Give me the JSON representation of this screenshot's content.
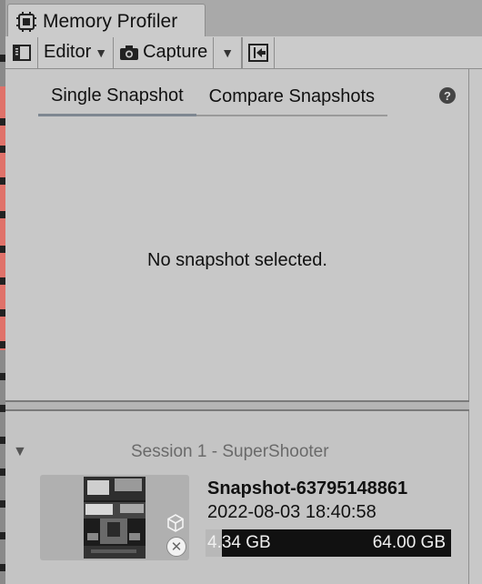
{
  "window": {
    "tab_title": "Memory Profiler"
  },
  "toolbar": {
    "editor_label": "Editor",
    "capture_label": "Capture"
  },
  "view_tabs": [
    {
      "label": "Single Snapshot",
      "active": true
    },
    {
      "label": "Compare Snapshots",
      "active": false
    }
  ],
  "main": {
    "empty_message": "No snapshot selected."
  },
  "session": {
    "label": "Session 1 - SuperShooter",
    "snapshot": {
      "name": "Snapshot-63795148861",
      "date": "2022-08-03 18:40:58",
      "memory_used": "4.34 GB",
      "memory_total": "64.00 GB",
      "memory_fraction": 0.068
    }
  },
  "colors": {
    "panel_bg": "#c8c8c8",
    "tab_active_underline": "#7e8791",
    "memory_bar": "#111111"
  }
}
